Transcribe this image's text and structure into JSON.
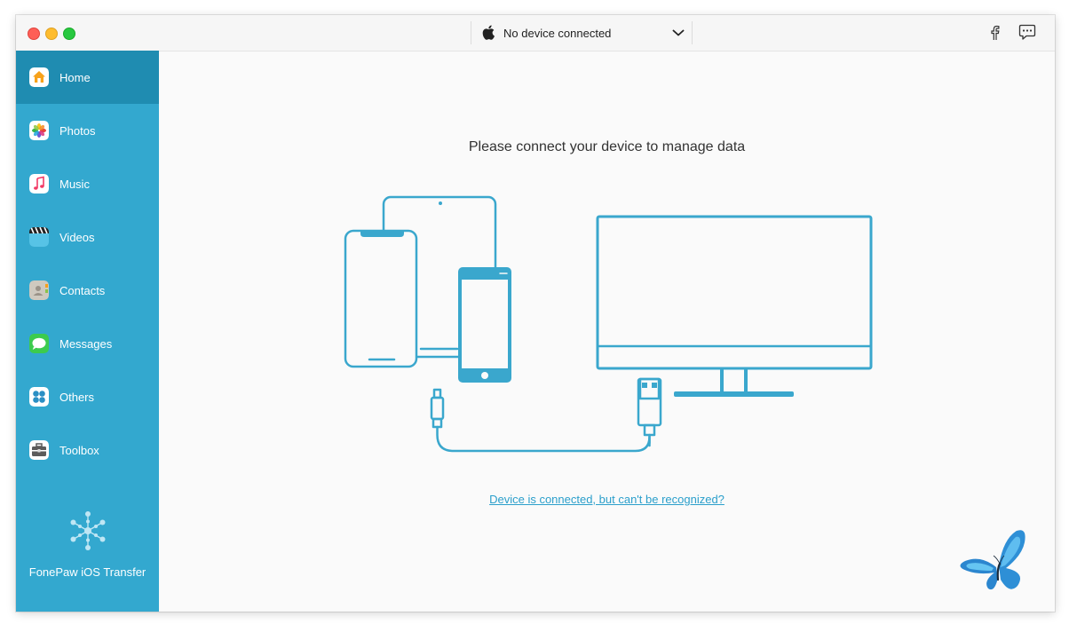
{
  "titlebar": {
    "device_status": "No device connected",
    "icons": [
      "apple-logo-icon",
      "chevron-down-icon",
      "facebook-icon",
      "feedback-chat-icon"
    ]
  },
  "sidebar": {
    "items": [
      {
        "label": "Home",
        "icon": "home-icon",
        "active": true
      },
      {
        "label": "Photos",
        "icon": "photos-icon",
        "active": false
      },
      {
        "label": "Music",
        "icon": "music-icon",
        "active": false
      },
      {
        "label": "Videos",
        "icon": "videos-icon",
        "active": false
      },
      {
        "label": "Contacts",
        "icon": "contacts-icon",
        "active": false
      },
      {
        "label": "Messages",
        "icon": "messages-icon",
        "active": false
      },
      {
        "label": "Others",
        "icon": "others-icon",
        "active": false
      },
      {
        "label": "Toolbox",
        "icon": "toolbox-icon",
        "active": false
      }
    ],
    "brand": "FonePaw iOS Transfer"
  },
  "main": {
    "heading": "Please connect your device to manage data",
    "help_link": "Device is connected, but can't be recognized?"
  },
  "colors": {
    "sidebar": "#33a8cf",
    "sidebar_active": "#1f8cb1",
    "illustration": "#3aa7cd",
    "link": "#2b9fcb"
  }
}
